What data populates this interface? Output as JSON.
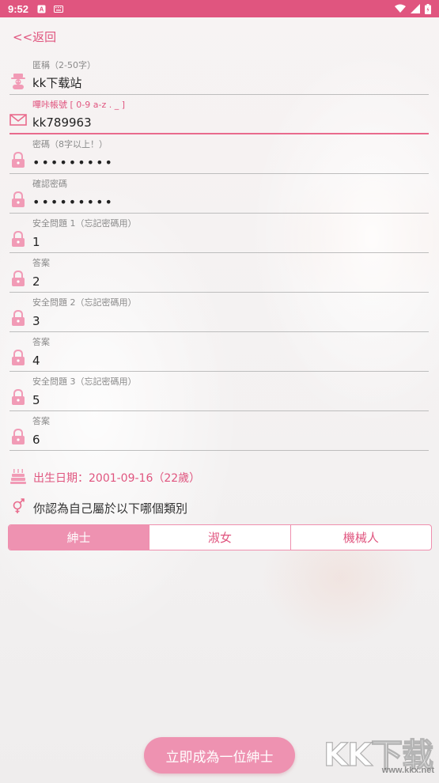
{
  "status_bar": {
    "time": "9:52",
    "icons": [
      "a-icon",
      "keyboard-icon",
      "wifi-icon",
      "signal-icon",
      "battery-icon"
    ]
  },
  "back_label": "<<返回",
  "fields": [
    {
      "label": "匿稱（2-50字）",
      "value": "kk下载站",
      "icon": "user-icon"
    },
    {
      "label": "嗶咔帳號 [ 0-9 a-z . _ ]",
      "value": "kk789963",
      "icon": "mail-icon"
    },
    {
      "label": "密碼（8字以上！）",
      "value": "•••••••••",
      "icon": "lock-icon"
    },
    {
      "label": "確認密碼",
      "value": "•••••••••",
      "icon": "lock-icon"
    },
    {
      "label": "安全問題 1（忘記密碼用）",
      "value": "1",
      "icon": "lock-icon"
    },
    {
      "label": "答案",
      "value": "2",
      "icon": "lock-icon"
    },
    {
      "label": "安全問題 2（忘記密碼用）",
      "value": "3",
      "icon": "lock-icon"
    },
    {
      "label": "答案",
      "value": "4",
      "icon": "lock-icon"
    },
    {
      "label": "安全問題 3（忘記密碼用）",
      "value": "5",
      "icon": "lock-icon"
    },
    {
      "label": "答案",
      "value": "6",
      "icon": "lock-icon"
    }
  ],
  "birthday": "出生日期：2001-09-16（22歲）",
  "gender": {
    "question": "你認為自己屬於以下哪個類別",
    "options": [
      "紳士",
      "淑女",
      "機械人"
    ],
    "selected": "紳士"
  },
  "submit_label": "立即成為一位紳士",
  "watermark": {
    "big": "KK下载",
    "small": "www.kkx.net"
  },
  "colors": {
    "accent": "#e0557f",
    "button": "#ee92b1",
    "segment_border": "#ef8fae"
  }
}
